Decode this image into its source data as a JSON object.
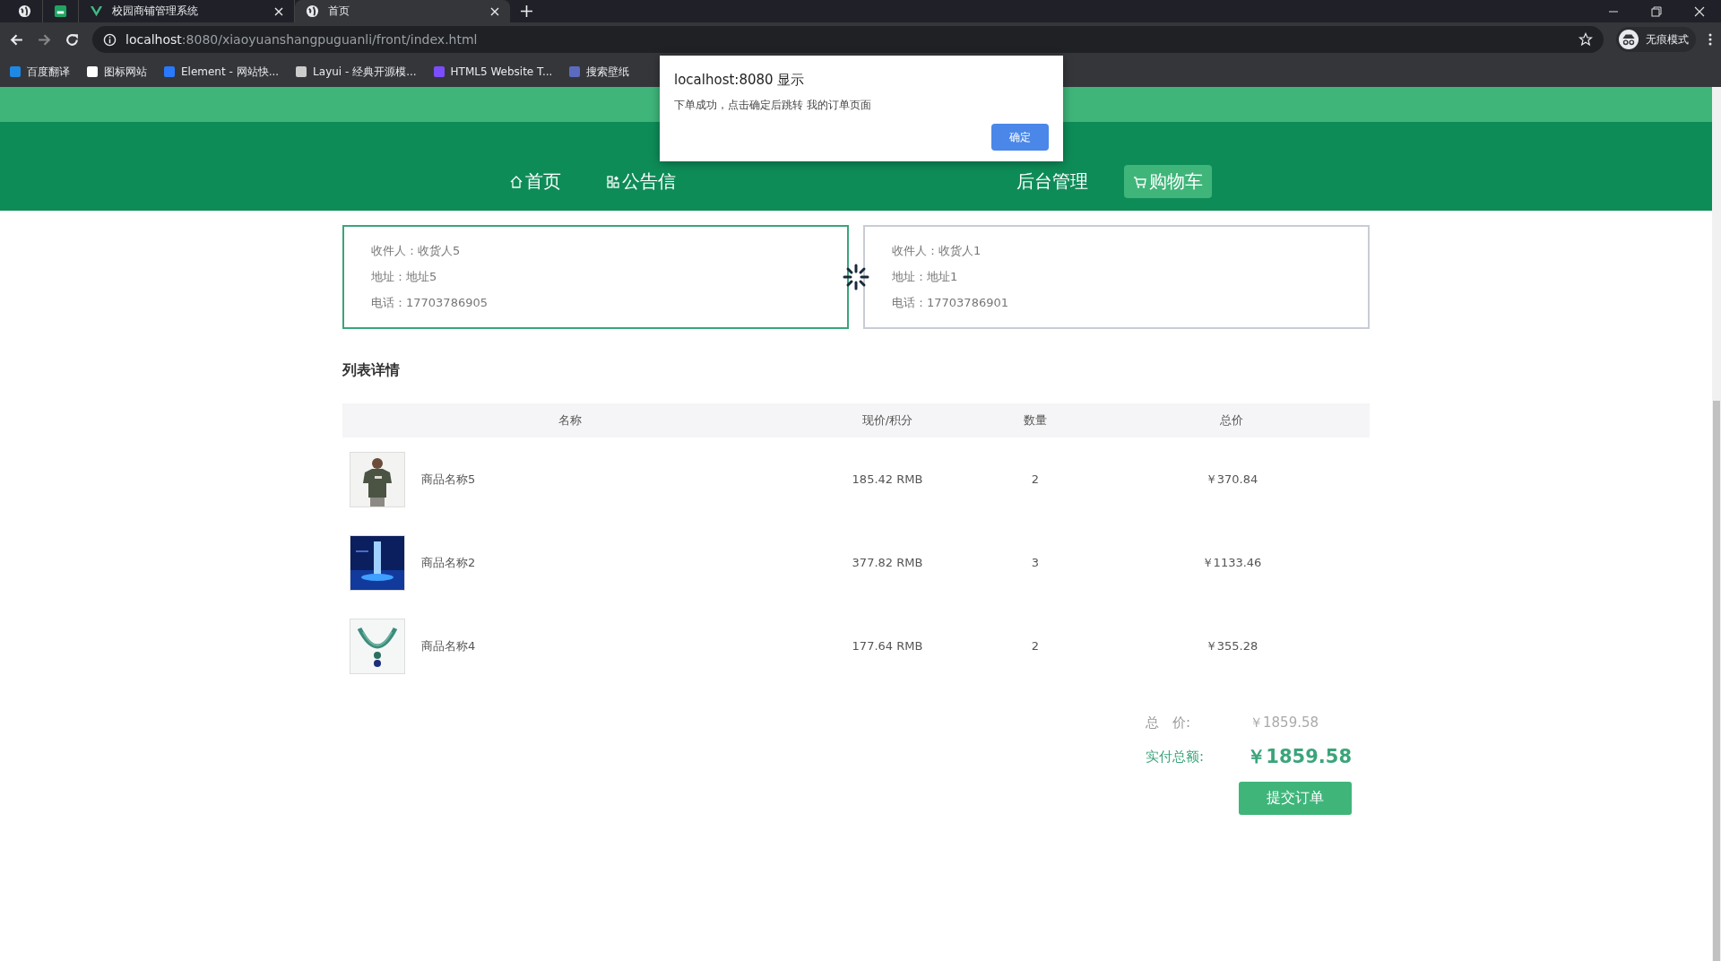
{
  "browser": {
    "tabs": [
      {
        "selected": false
      },
      {
        "selected": false
      },
      {
        "title": "校园商铺管理系统",
        "selected": false
      },
      {
        "title": "首页",
        "selected": true
      }
    ],
    "address": {
      "host": "localhost",
      "path": ":8080/xiaoyuanshangpuguanli/front/index.html"
    },
    "bookmarks": [
      "百度翻译",
      "图标网站",
      "Element - 网站快...",
      "Layui - 经典开源模...",
      "HTML5 Website T...",
      "搜索壁纸"
    ],
    "profile": "无痕模式"
  },
  "dialog": {
    "title": "localhost:8080 显示",
    "message": "下单成功，点击确定后跳转 我的订单页面",
    "button": "确定"
  },
  "nav": {
    "items": [
      {
        "label": "首页",
        "selected": false
      },
      {
        "label": "公告信",
        "selected": false
      },
      {
        "label": "后台管理",
        "selected": false
      },
      {
        "label": "购物车",
        "selected": true
      }
    ]
  },
  "addresses": [
    {
      "lines": [
        "收件人：收货人5",
        "地址：地址5",
        "电话：17703786905"
      ],
      "selected": true
    },
    {
      "lines": [
        "收件人：收货人1",
        "地址：地址1",
        "电话：17703786901"
      ],
      "selected": false
    }
  ],
  "section_title": "列表详情",
  "table": {
    "columns": [
      "名称",
      "现价/积分",
      "数量",
      "总价"
    ],
    "rows": [
      {
        "name": "商品名称5",
        "price": "185.42 RMB",
        "quantity": "2",
        "total": "￥370.84"
      },
      {
        "name": "商品名称2",
        "price": "377.82 RMB",
        "quantity": "3",
        "total": "￥1133.46"
      },
      {
        "name": "商品名称4",
        "price": "177.64 RMB",
        "quantity": "2",
        "total": "￥355.28"
      }
    ]
  },
  "summary": {
    "total_label": "总　价:",
    "total": "￥1859.58",
    "paid_label": "实付总额:",
    "paid": "￥1859.58",
    "submit": "提交订单"
  }
}
